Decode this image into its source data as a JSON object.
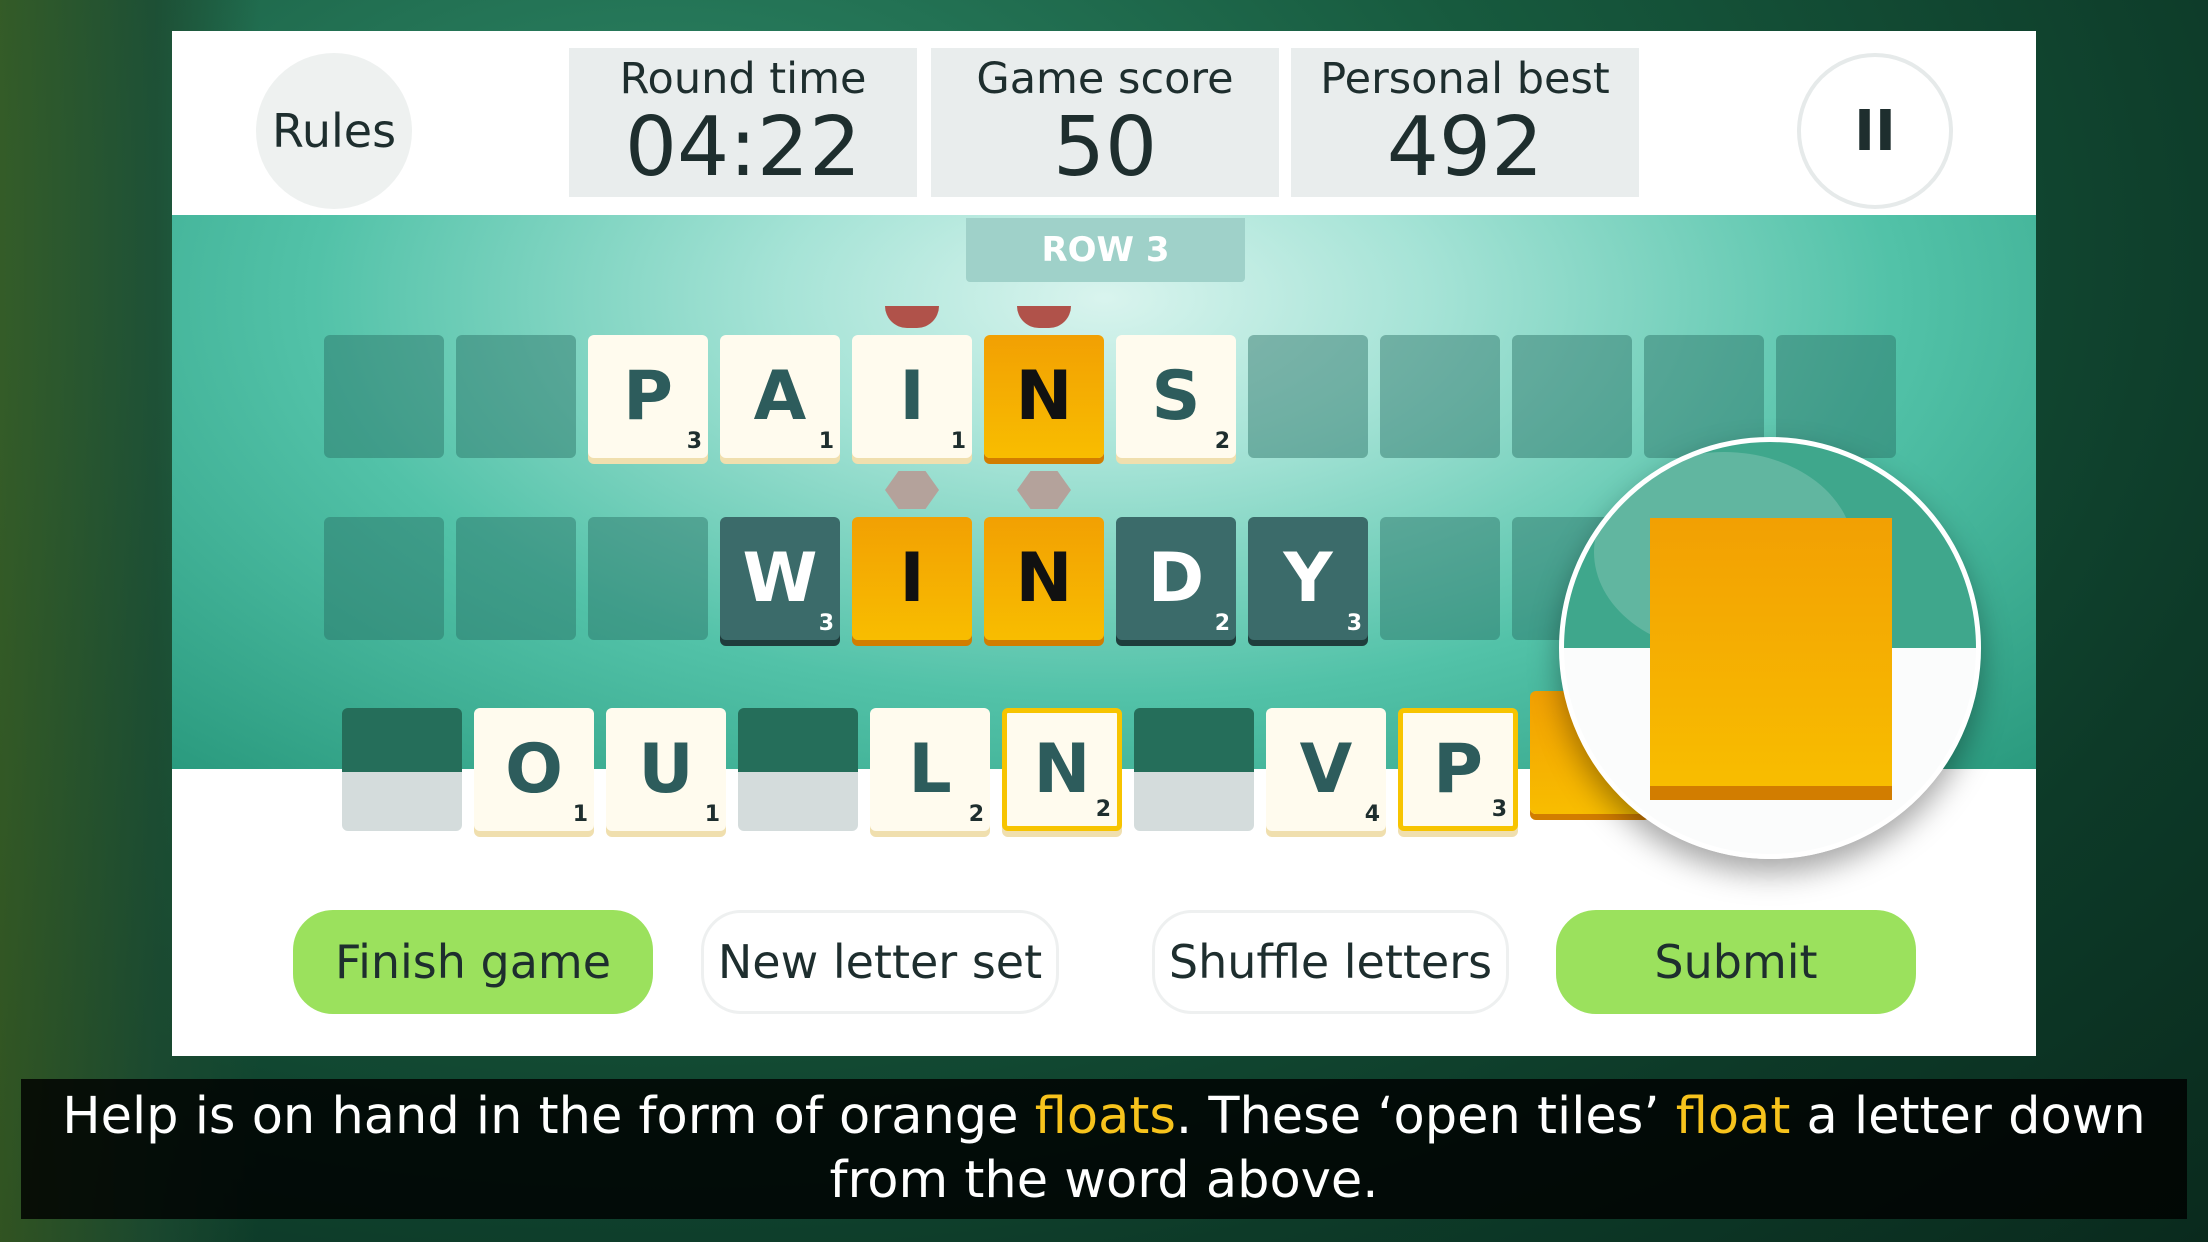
{
  "header": {
    "rules_label": "Rules",
    "pause_icon": "pause-icon",
    "pause_glyph": "II",
    "stats": [
      {
        "label": "Round time",
        "value": "04:22"
      },
      {
        "label": "Game score",
        "value": "50"
      },
      {
        "label": "Personal best",
        "value": "492"
      }
    ]
  },
  "board": {
    "row_label": "ROW 3",
    "row1": [
      {
        "l": "P",
        "p": "3"
      },
      {
        "l": "A",
        "p": "1"
      },
      {
        "l": "I",
        "p": "1"
      },
      {
        "l": "N",
        "p": ""
      },
      {
        "l": "S",
        "p": "2"
      }
    ],
    "row2": [
      {
        "l": "W",
        "p": "3"
      },
      {
        "l": "I",
        "p": ""
      },
      {
        "l": "N",
        "p": ""
      },
      {
        "l": "D",
        "p": "2"
      },
      {
        "l": "Y",
        "p": "3"
      }
    ],
    "rack": [
      {
        "l": "O",
        "p": "1"
      },
      {
        "l": "U",
        "p": "1"
      },
      {
        "l": "L",
        "p": "2"
      },
      {
        "l": "N",
        "p": "2"
      },
      {
        "l": "V",
        "p": "4"
      },
      {
        "l": "P",
        "p": "3"
      }
    ]
  },
  "buttons": {
    "finish": "Finish game",
    "new_set": "New letter set",
    "shuffle": "Shuffle letters",
    "submit": "Submit"
  },
  "caption": {
    "p1": "Help is on hand in the form of orange ",
    "h1": "floats",
    "p2": ". These ‘open tiles’ ",
    "h2": "float",
    "p3": " a letter down from the word above."
  },
  "colors": {
    "accent_green": "#9be15d",
    "float_orange": "#f8bd00",
    "tile_dark": "#3b6b6a",
    "highlight": "#f7c31c"
  }
}
